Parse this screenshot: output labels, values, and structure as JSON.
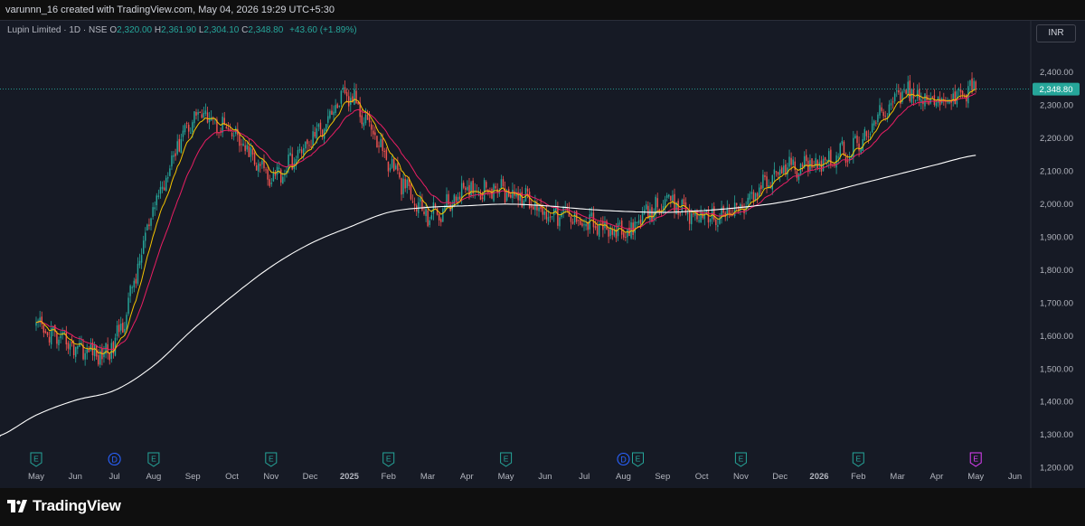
{
  "header": {
    "credit": "varunnn_16 created with TradingView.com, May 04, 2026 19:29 UTC+5:30"
  },
  "legend": {
    "symbol": "Lupin Limited · 1D · NSE",
    "open_label": "O",
    "open": "2,320.00",
    "high_label": "H",
    "high": "2,361.90",
    "low_label": "L",
    "low": "2,304.10",
    "close_label": "C",
    "close": "2,348.80",
    "change": "+43.60 (+1.89%)"
  },
  "currency_button": "INR",
  "footer": {
    "brand": "TradingView"
  },
  "colors": {
    "background": "#161a25",
    "up": "#26a69a",
    "down": "#ef5350",
    "ma_fast": "#f5c400",
    "ma_mid": "#e91e63",
    "ma_slow": "#ffffff",
    "earnings": "#26a69a",
    "dividend": "#2962ff",
    "earnings_next": "#e040fb"
  },
  "chart_data": {
    "type": "candlestick",
    "y_axis": {
      "ylim": [
        1180,
        2460
      ],
      "ticks": [
        1200,
        1300,
        1400,
        1500,
        1600,
        1700,
        1800,
        1900,
        2000,
        2100,
        2200,
        2300,
        2400
      ],
      "tick_labels": [
        "1,200.00",
        "1,300.00",
        "1,400.00",
        "1,500.00",
        "1,600.00",
        "1,700.00",
        "1,800.00",
        "1,900.00",
        "2,000.00",
        "2,100.00",
        "2,200.00",
        "2,300.00",
        "2,400.00"
      ],
      "position": "right"
    },
    "last_price": {
      "value": 2348.8,
      "label": "2,348.80"
    },
    "x_axis": {
      "labels": [
        "May",
        "Jun",
        "Jul",
        "Aug",
        "Sep",
        "Oct",
        "Nov",
        "Dec",
        "2025",
        "Feb",
        "Mar",
        "Apr",
        "May",
        "Jun",
        "Jul",
        "Aug",
        "Sep",
        "Oct",
        "Nov",
        "Dec",
        "2026",
        "Feb",
        "Mar",
        "Apr",
        "May",
        "Jun"
      ],
      "bold": [
        false,
        false,
        false,
        false,
        false,
        false,
        false,
        false,
        true,
        false,
        false,
        false,
        false,
        false,
        false,
        false,
        false,
        false,
        false,
        false,
        true,
        false,
        false,
        false,
        false,
        false
      ]
    },
    "series": [
      {
        "kind": "price",
        "dates": [
          "2024-05",
          "2024-06",
          "2024-07",
          "2024-08",
          "2024-09",
          "2024-10",
          "2024-11",
          "2024-12",
          "2025-01",
          "2025-02",
          "2025-03",
          "2025-04",
          "2025-05",
          "2025-06",
          "2025-07",
          "2025-08",
          "2025-09",
          "2025-10",
          "2025-11",
          "2025-12",
          "2026-01",
          "2026-02",
          "2026-03",
          "2026-04",
          "2026-05"
        ],
        "close": [
          1620,
          1570,
          1580,
          1980,
          2260,
          2210,
          2090,
          2190,
          2320,
          2130,
          1970,
          2040,
          2040,
          1980,
          1950,
          1910,
          2000,
          1960,
          1990,
          2100,
          2130,
          2180,
          2330,
          2310,
          2348.8
        ]
      },
      {
        "kind": "moving-average",
        "color_key": "ma_slow",
        "dates": [
          "2024-04",
          "2024-05",
          "2024-06",
          "2024-07",
          "2024-08",
          "2024-09",
          "2024-10",
          "2024-11",
          "2024-12",
          "2025-01",
          "2025-02",
          "2025-03",
          "2025-04",
          "2025-05",
          "2025-06",
          "2025-07",
          "2025-08",
          "2025-09",
          "2025-10",
          "2025-11",
          "2025-12",
          "2026-01",
          "2026-02",
          "2026-03",
          "2026-04",
          "2026-05"
        ],
        "values": [
          1295,
          1360,
          1405,
          1435,
          1510,
          1620,
          1720,
          1810,
          1880,
          1930,
          1975,
          1990,
          1995,
          2000,
          1995,
          1985,
          1978,
          1975,
          1980,
          1990,
          2005,
          2030,
          2060,
          2090,
          2120,
          2148
        ]
      }
    ],
    "events": [
      {
        "type": "E",
        "month": "2024-05"
      },
      {
        "type": "D",
        "month": "2024-07"
      },
      {
        "type": "E",
        "month": "2024-08"
      },
      {
        "type": "E",
        "month": "2024-11"
      },
      {
        "type": "E",
        "month": "2025-02"
      },
      {
        "type": "E",
        "month": "2025-05"
      },
      {
        "type": "D",
        "month": "2025-08"
      },
      {
        "type": "E",
        "month": "2025-08"
      },
      {
        "type": "E",
        "month": "2025-11"
      },
      {
        "type": "E",
        "month": "2026-02"
      },
      {
        "type": "E",
        "month": "2026-05",
        "upcoming": true
      }
    ]
  }
}
